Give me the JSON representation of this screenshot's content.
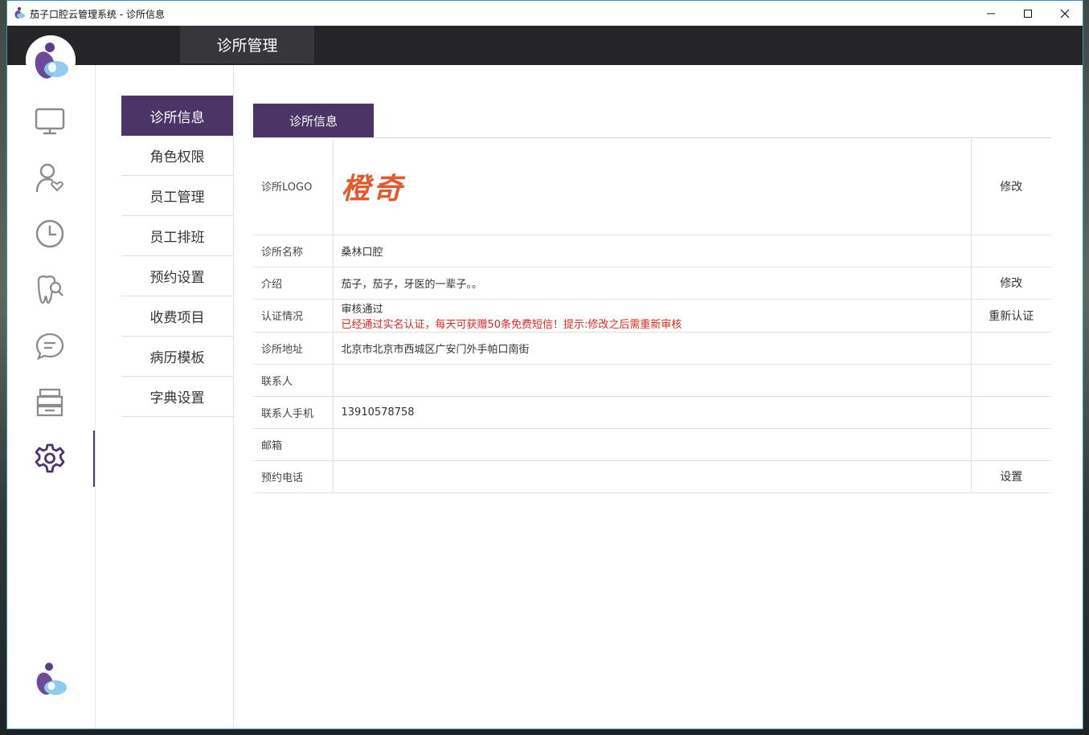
{
  "window": {
    "title": "茄子口腔云管理系统 - 诊所信息"
  },
  "header": {
    "tab_label": "诊所管理"
  },
  "submenu": {
    "items": [
      {
        "label": "诊所信息"
      },
      {
        "label": "角色权限"
      },
      {
        "label": "员工管理"
      },
      {
        "label": "员工排班"
      },
      {
        "label": "预约设置"
      },
      {
        "label": "收费项目"
      },
      {
        "label": "病历模板"
      },
      {
        "label": "字典设置"
      }
    ]
  },
  "content": {
    "tab_label": "诊所信息",
    "rows": [
      {
        "label": "诊所LOGO",
        "logo_text": "橙奇",
        "action": "修改"
      },
      {
        "label": "诊所名称",
        "value": "桑林口腔",
        "action": ""
      },
      {
        "label": "介绍",
        "value": "茄子，茄子，牙医的一辈子。。",
        "action": "修改"
      },
      {
        "label": "认证情况",
        "value": "审核通过",
        "note": "已经通过实名认证，每天可获赠50条免费短信！提示:修改之后需重新审核",
        "action": "重新认证"
      },
      {
        "label": "诊所地址",
        "value": "北京市北京市西城区广安门外手帕口南街",
        "action": ""
      },
      {
        "label": "联系人",
        "value": "",
        "action": ""
      },
      {
        "label": "联系人手机",
        "value": "13910578758",
        "action": ""
      },
      {
        "label": "邮箱",
        "value": "",
        "action": ""
      },
      {
        "label": "预约电话",
        "value": "",
        "action": "设置"
      }
    ]
  },
  "icons": {
    "sidebar": [
      "monitor-icon",
      "patient-icon",
      "clock-icon",
      "tooth-search-icon",
      "chat-icon",
      "archive-icon",
      "gear-icon"
    ]
  },
  "colors": {
    "accent": "#4a3566",
    "header_bg": "#252528",
    "warning_text": "#d9281e",
    "logo_text": "#e25a2c"
  }
}
